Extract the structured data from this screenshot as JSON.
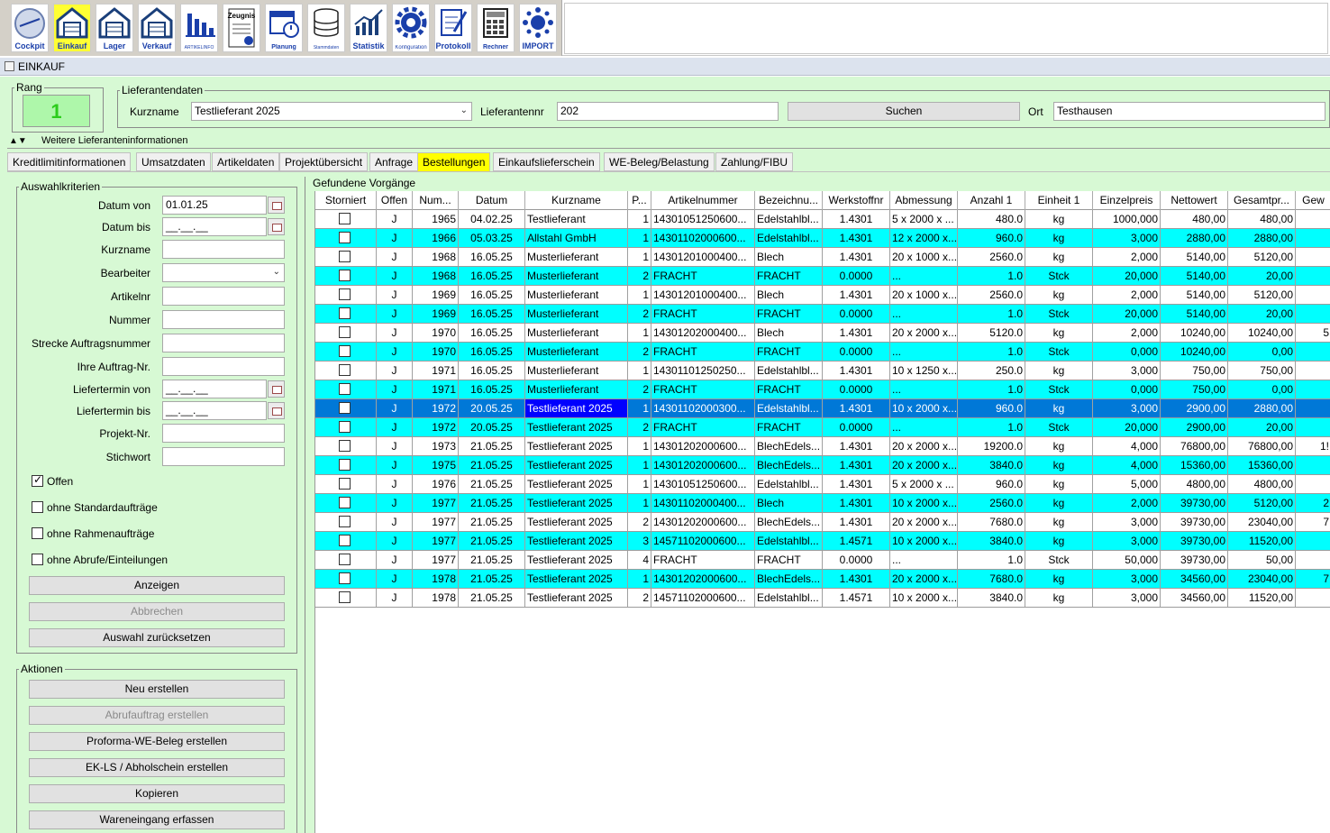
{
  "toolbar": {
    "buttons": [
      {
        "label": "Cockpit",
        "icon": "gauge-icon"
      },
      {
        "label": "Einkauf",
        "icon": "warehouse-icon"
      },
      {
        "label": "Lager",
        "icon": "warehouse-icon"
      },
      {
        "label": "Verkauf",
        "icon": "warehouse-icon"
      },
      {
        "label": "ARTIKELINFO",
        "icon": "bar-chart-icon"
      },
      {
        "label": "Zeugnis",
        "icon": "certificate-icon"
      },
      {
        "label": "Planung",
        "icon": "calendar-clock-icon"
      },
      {
        "label": "Stammdaten",
        "icon": "database-icon"
      },
      {
        "label": "Statistik",
        "icon": "statistics-icon"
      },
      {
        "label": "Konfiguration",
        "icon": "gear-icon"
      },
      {
        "label": "Protokoll",
        "icon": "notepad-icon"
      },
      {
        "label": "Rechner",
        "icon": "calculator-icon"
      },
      {
        "label": "IMPORT",
        "icon": "import-icon"
      }
    ],
    "active": "Einkauf"
  },
  "window": {
    "title": "EINKAUF"
  },
  "rang": {
    "legend": "Rang",
    "value": "1"
  },
  "lieferantendaten": {
    "legend": "Lieferantendaten",
    "kurzname_label": "Kurzname",
    "kurzname_value": "Testlieferant 2025",
    "nr_label": "Lieferantennr",
    "nr_value": "202",
    "search_label": "Suchen",
    "ort_label": "Ort",
    "ort_value": "Testhausen"
  },
  "more_info": "Weitere Lieferanteninformationen",
  "tabs": [
    "Kreditlimitinformationen",
    "Umsatzdaten",
    "Artikeldaten",
    "Projektübersicht",
    "Anfrage",
    "Bestellungen",
    "Einkaufslieferschein",
    "WE-Beleg/Belastung",
    "Zahlung/FIBU"
  ],
  "active_tab": "Bestellungen",
  "criteria": {
    "legend": "Auswahlkriterien",
    "datum_von_label": "Datum von",
    "datum_von": "01.01.25",
    "datum_bis_label": "Datum bis",
    "datum_bis": "__.__.__",
    "kurzname_label": "Kurzname",
    "bearbeiter_label": "Bearbeiter",
    "artikelnr_label": "Artikelnr",
    "nummer_label": "Nummer",
    "strecke_label": "Strecke Auftragsnummer",
    "ihre_label": "Ihre Auftrag-Nr.",
    "lt_von_label": "Liefertermin von",
    "lt_von": "__.__.__",
    "lt_bis_label": "Liefertermin bis",
    "lt_bis": "__.__.__",
    "projekt_label": "Projekt-Nr.",
    "stichwort_label": "Stichwort",
    "offen_label": "Offen",
    "ohne_std_label": "ohne Standardaufträge",
    "ohne_rahmen_label": "ohne Rahmenaufträge",
    "ohne_abrufe_label": "ohne Abrufe/Einteilungen",
    "anzeigen": "Anzeigen",
    "abbrechen": "Abbrechen",
    "reset": "Auswahl zurücksetzen"
  },
  "actions": {
    "legend": "Aktionen",
    "neu": "Neu erstellen",
    "abruf": "Abrufauftrag erstellen",
    "proforma": "Proforma-WE-Beleg erstellen",
    "ekls": "EK-LS / Abholschein erstellen",
    "kopieren": "Kopieren",
    "wareneingang": "Wareneingang erfassen"
  },
  "grid": {
    "legend": "Gefundene Vorgänge",
    "columns": [
      "Storniert",
      "Offen",
      "Num...",
      "Datum",
      "Kurzname",
      "P...",
      "Artikelnummer",
      "Bezeichnu...",
      "Werkstoffnr",
      "Abmessung",
      "Anzahl 1",
      "Einheit 1",
      "Einzelpreis",
      "Nettowert",
      "Gesamtpr...",
      "Gew"
    ],
    "rows": [
      {
        "offen": "J",
        "num": "1965",
        "datum": "04.02.25",
        "kurzname": "Testlieferant",
        "p": "1",
        "artikel": "14301051250600...",
        "bez": "Edelstahlbl...",
        "werkstoff": "1.4301",
        "abm": "5 x 2000 x ...",
        "anzahl": "480.0",
        "einheit": "kg",
        "preis": "1000,000",
        "netto": "480,00",
        "gesamt": "480,00",
        "gew": ""
      },
      {
        "offen": "J",
        "num": "1966",
        "datum": "05.03.25",
        "kurzname": "Allstahl GmbH",
        "p": "1",
        "artikel": "14301102000600...",
        "bez": "Edelstahlbl...",
        "werkstoff": "1.4301",
        "abm": "12 x 2000 x...",
        "anzahl": "960.0",
        "einheit": "kg",
        "preis": "3,000",
        "netto": "2880,00",
        "gesamt": "2880,00",
        "gew": ""
      },
      {
        "offen": "J",
        "num": "1968",
        "datum": "16.05.25",
        "kurzname": "Musterlieferant",
        "p": "1",
        "artikel": "14301201000400...",
        "bez": "Blech",
        "werkstoff": "1.4301",
        "abm": "20 x 1000 x...",
        "anzahl": "2560.0",
        "einheit": "kg",
        "preis": "2,000",
        "netto": "5140,00",
        "gesamt": "5120,00",
        "gew": ""
      },
      {
        "offen": "J",
        "num": "1968",
        "datum": "16.05.25",
        "kurzname": "Musterlieferant",
        "p": "2",
        "artikel": "FRACHT",
        "bez": "FRACHT",
        "werkstoff": "0.0000",
        "abm": "...",
        "anzahl": "1.0",
        "einheit": "Stck",
        "preis": "20,000",
        "netto": "5140,00",
        "gesamt": "20,00",
        "gew": ""
      },
      {
        "offen": "J",
        "num": "1969",
        "datum": "16.05.25",
        "kurzname": "Musterlieferant",
        "p": "1",
        "artikel": "14301201000400...",
        "bez": "Blech",
        "werkstoff": "1.4301",
        "abm": "20 x 1000 x...",
        "anzahl": "2560.0",
        "einheit": "kg",
        "preis": "2,000",
        "netto": "5140,00",
        "gesamt": "5120,00",
        "gew": ""
      },
      {
        "offen": "J",
        "num": "1969",
        "datum": "16.05.25",
        "kurzname": "Musterlieferant",
        "p": "2",
        "artikel": "FRACHT",
        "bez": "FRACHT",
        "werkstoff": "0.0000",
        "abm": "...",
        "anzahl": "1.0",
        "einheit": "Stck",
        "preis": "20,000",
        "netto": "5140,00",
        "gesamt": "20,00",
        "gew": ""
      },
      {
        "offen": "J",
        "num": "1970",
        "datum": "16.05.25",
        "kurzname": "Musterlieferant",
        "p": "1",
        "artikel": "14301202000400...",
        "bez": "Blech",
        "werkstoff": "1.4301",
        "abm": "20 x 2000 x...",
        "anzahl": "5120.0",
        "einheit": "kg",
        "preis": "2,000",
        "netto": "10240,00",
        "gesamt": "10240,00",
        "gew": "5"
      },
      {
        "offen": "J",
        "num": "1970",
        "datum": "16.05.25",
        "kurzname": "Musterlieferant",
        "p": "2",
        "artikel": "FRACHT",
        "bez": "FRACHT",
        "werkstoff": "0.0000",
        "abm": "...",
        "anzahl": "1.0",
        "einheit": "Stck",
        "preis": "0,000",
        "netto": "10240,00",
        "gesamt": "0,00",
        "gew": ""
      },
      {
        "offen": "J",
        "num": "1971",
        "datum": "16.05.25",
        "kurzname": "Musterlieferant",
        "p": "1",
        "artikel": "14301101250250...",
        "bez": "Edelstahlbl...",
        "werkstoff": "1.4301",
        "abm": "10 x 1250 x...",
        "anzahl": "250.0",
        "einheit": "kg",
        "preis": "3,000",
        "netto": "750,00",
        "gesamt": "750,00",
        "gew": ""
      },
      {
        "offen": "J",
        "num": "1971",
        "datum": "16.05.25",
        "kurzname": "Musterlieferant",
        "p": "2",
        "artikel": "FRACHT",
        "bez": "FRACHT",
        "werkstoff": "0.0000",
        "abm": "...",
        "anzahl": "1.0",
        "einheit": "Stck",
        "preis": "0,000",
        "netto": "750,00",
        "gesamt": "0,00",
        "gew": ""
      },
      {
        "offen": "J",
        "num": "1972",
        "datum": "20.05.25",
        "kurzname": "Testlieferant 2025",
        "p": "1",
        "artikel": "14301102000300...",
        "bez": "Edelstahlbl...",
        "werkstoff": "1.4301",
        "abm": "10 x 2000 x...",
        "anzahl": "960.0",
        "einheit": "kg",
        "preis": "3,000",
        "netto": "2900,00",
        "gesamt": "2880,00",
        "gew": ""
      },
      {
        "offen": "J",
        "num": "1972",
        "datum": "20.05.25",
        "kurzname": "Testlieferant 2025",
        "p": "2",
        "artikel": "FRACHT",
        "bez": "FRACHT",
        "werkstoff": "0.0000",
        "abm": "...",
        "anzahl": "1.0",
        "einheit": "Stck",
        "preis": "20,000",
        "netto": "2900,00",
        "gesamt": "20,00",
        "gew": ""
      },
      {
        "offen": "J",
        "num": "1973",
        "datum": "21.05.25",
        "kurzname": "Testlieferant 2025",
        "p": "1",
        "artikel": "14301202000600...",
        "bez": "BlechEdels...",
        "werkstoff": "1.4301",
        "abm": "20 x 2000 x...",
        "anzahl": "19200.0",
        "einheit": "kg",
        "preis": "4,000",
        "netto": "76800,00",
        "gesamt": "76800,00",
        "gew": "1!"
      },
      {
        "offen": "J",
        "num": "1975",
        "datum": "21.05.25",
        "kurzname": "Testlieferant 2025",
        "p": "1",
        "artikel": "14301202000600...",
        "bez": "BlechEdels...",
        "werkstoff": "1.4301",
        "abm": "20 x 2000 x...",
        "anzahl": "3840.0",
        "einheit": "kg",
        "preis": "4,000",
        "netto": "15360,00",
        "gesamt": "15360,00",
        "gew": ""
      },
      {
        "offen": "J",
        "num": "1976",
        "datum": "21.05.25",
        "kurzname": "Testlieferant 2025",
        "p": "1",
        "artikel": "14301051250600...",
        "bez": "Edelstahlbl...",
        "werkstoff": "1.4301",
        "abm": "5 x 2000 x ...",
        "anzahl": "960.0",
        "einheit": "kg",
        "preis": "5,000",
        "netto": "4800,00",
        "gesamt": "4800,00",
        "gew": ""
      },
      {
        "offen": "J",
        "num": "1977",
        "datum": "21.05.25",
        "kurzname": "Testlieferant 2025",
        "p": "1",
        "artikel": "14301102000400...",
        "bez": "Blech",
        "werkstoff": "1.4301",
        "abm": "10 x 2000 x...",
        "anzahl": "2560.0",
        "einheit": "kg",
        "preis": "2,000",
        "netto": "39730,00",
        "gesamt": "5120,00",
        "gew": "2"
      },
      {
        "offen": "J",
        "num": "1977",
        "datum": "21.05.25",
        "kurzname": "Testlieferant 2025",
        "p": "2",
        "artikel": "14301202000600...",
        "bez": "BlechEdels...",
        "werkstoff": "1.4301",
        "abm": "20 x 2000 x...",
        "anzahl": "7680.0",
        "einheit": "kg",
        "preis": "3,000",
        "netto": "39730,00",
        "gesamt": "23040,00",
        "gew": "7"
      },
      {
        "offen": "J",
        "num": "1977",
        "datum": "21.05.25",
        "kurzname": "Testlieferant 2025",
        "p": "3",
        "artikel": "14571102000600...",
        "bez": "Edelstahlbl...",
        "werkstoff": "1.4571",
        "abm": "10 x 2000 x...",
        "anzahl": "3840.0",
        "einheit": "kg",
        "preis": "3,000",
        "netto": "39730,00",
        "gesamt": "11520,00",
        "gew": ""
      },
      {
        "offen": "J",
        "num": "1977",
        "datum": "21.05.25",
        "kurzname": "Testlieferant 2025",
        "p": "4",
        "artikel": "FRACHT",
        "bez": "FRACHT",
        "werkstoff": "0.0000",
        "abm": "...",
        "anzahl": "1.0",
        "einheit": "Stck",
        "preis": "50,000",
        "netto": "39730,00",
        "gesamt": "50,00",
        "gew": ""
      },
      {
        "offen": "J",
        "num": "1978",
        "datum": "21.05.25",
        "kurzname": "Testlieferant 2025",
        "p": "1",
        "artikel": "14301202000600...",
        "bez": "BlechEdels...",
        "werkstoff": "1.4301",
        "abm": "20 x 2000 x...",
        "anzahl": "7680.0",
        "einheit": "kg",
        "preis": "3,000",
        "netto": "34560,00",
        "gesamt": "23040,00",
        "gew": "7"
      },
      {
        "offen": "J",
        "num": "1978",
        "datum": "21.05.25",
        "kurzname": "Testlieferant 2025",
        "p": "2",
        "artikel": "14571102000600...",
        "bez": "Edelstahlbl...",
        "werkstoff": "1.4571",
        "abm": "10 x 2000 x...",
        "anzahl": "3840.0",
        "einheit": "kg",
        "preis": "3,000",
        "netto": "34560,00",
        "gesamt": "11520,00",
        "gew": ""
      }
    ],
    "selected_row": 10
  },
  "colors": {
    "row_alt": "#00ffff",
    "row_selected": "#0078d7",
    "panel_bg": "#d7f9d4",
    "active_tab": "#ffff00"
  }
}
